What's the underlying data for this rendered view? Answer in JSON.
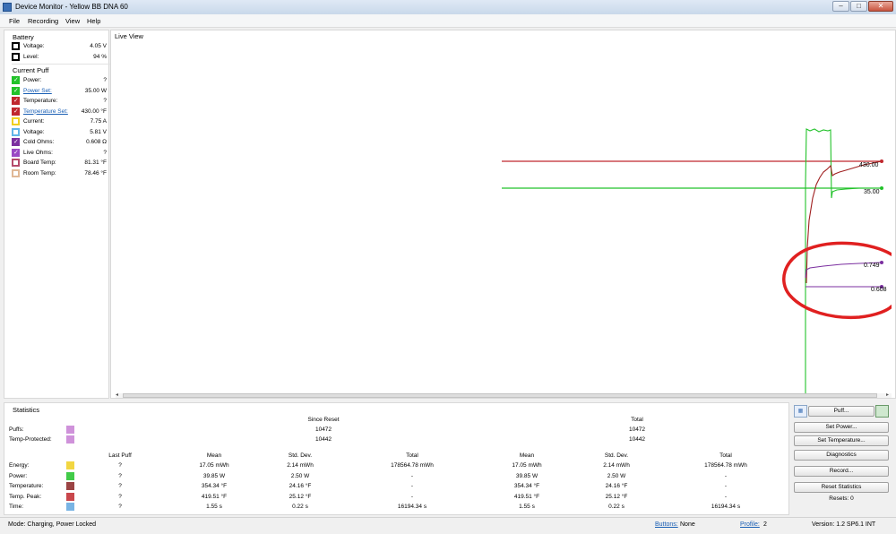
{
  "window": {
    "title": "Device Monitor - Yellow BB DNA 60"
  },
  "menu": [
    "File",
    "Recording",
    "View",
    "Help"
  ],
  "battery": {
    "heading": "Battery",
    "rows": [
      {
        "label": "Voltage:",
        "value": "4.05 V",
        "color": "#000000"
      },
      {
        "label": "Level:",
        "value": "94 %",
        "color": "#000000"
      }
    ]
  },
  "current_puff": {
    "heading": "Current Puff",
    "rows": [
      {
        "label": "Power:",
        "value": "?",
        "color": "#22c22a",
        "checked": true,
        "link": false
      },
      {
        "label": "Power Set:",
        "value": "35.00 W",
        "color": "#22c22a",
        "checked": true,
        "link": true
      },
      {
        "label": "Temperature:",
        "value": "?",
        "color": "#c0272d",
        "checked": true,
        "link": false
      },
      {
        "label": "Temperature Set:",
        "value": "430.00 °F",
        "color": "#c0272d",
        "checked": true,
        "link": true
      },
      {
        "label": "Current:",
        "value": "7.75 A",
        "color": "#f0d020",
        "checked": false,
        "link": false
      },
      {
        "label": "Voltage:",
        "value": "5.81 V",
        "color": "#62b6e8",
        "checked": false,
        "link": false
      },
      {
        "label": "Cold Ohms:",
        "value": "0.608 Ω",
        "color": "#7b2fa0",
        "checked": true,
        "link": false
      },
      {
        "label": "Live Ohms:",
        "value": "?",
        "color": "#9a48c4",
        "checked": true,
        "link": false
      },
      {
        "label": "Board Temp:",
        "value": "81.31 °F",
        "color": "#b44a6a",
        "checked": false,
        "link": false
      },
      {
        "label": "Room Temp:",
        "value": "78.46 °F",
        "color": "#e0b896",
        "checked": false,
        "link": false
      }
    ]
  },
  "live_view": {
    "heading": "Live View"
  },
  "chart_data": {
    "type": "line",
    "series_colors": {
      "power": "#22c22a",
      "temperature": "#c0272d",
      "ohms": "#7b2fa0"
    },
    "end_labels": [
      "430.00",
      "35.00",
      "0.749",
      "0.608"
    ],
    "annotation": "red hand-drawn circle around ohms traces"
  },
  "statistics": {
    "heading": "Statistics",
    "since_reset_label": "Since Reset",
    "total_label": "Total",
    "top_rows": [
      {
        "label": "Puffs:",
        "since_reset": "10472",
        "total": "10472",
        "color": "#c77fd4"
      },
      {
        "label": "Temp-Protected:",
        "since_reset": "10442",
        "total": "10442",
        "color": "#c77fd4"
      }
    ],
    "columns": [
      "Last Puff",
      "Mean",
      "Std. Dev.",
      "Total",
      "Mean",
      "Std. Dev.",
      "Total"
    ],
    "rows": [
      {
        "label": "Energy:",
        "color": "#f0d020",
        "values": [
          "?",
          "17.05 mWh",
          "2.14 mWh",
          "178564.78 mWh",
          "17.05 mWh",
          "2.14 mWh",
          "178564.78 mWh"
        ]
      },
      {
        "label": "Power:",
        "color": "#22c22a",
        "values": [
          "?",
          "39.85 W",
          "2.50 W",
          "-",
          "39.85 W",
          "2.50 W",
          "-"
        ]
      },
      {
        "label": "Temperature:",
        "color": "#8a2424",
        "values": [
          "?",
          "354.34 °F",
          "24.16 °F",
          "-",
          "354.34 °F",
          "24.16 °F",
          "-"
        ]
      },
      {
        "label": "Temp. Peak:",
        "color": "#c0272d",
        "values": [
          "?",
          "419.51 °F",
          "25.12 °F",
          "-",
          "419.51 °F",
          "25.12 °F",
          "-"
        ]
      },
      {
        "label": "Time:",
        "color": "#62a8e0",
        "values": [
          "?",
          "1.55 s",
          "0.22 s",
          "16194.34 s",
          "1.55 s",
          "0.22 s",
          "16194.34 s"
        ]
      }
    ]
  },
  "buttons": {
    "puff": "Puff...",
    "set_power": "Set Power...",
    "set_temperature": "Set Temperature...",
    "diagnostics": "Diagnostics",
    "record": "Record...",
    "reset_statistics": "Reset Statistics",
    "resets": "Resets: 0"
  },
  "status": {
    "mode": "Mode: Charging, Power Locked",
    "buttons_label": "Buttons:",
    "buttons_value": "None",
    "profile_label": "Profile:",
    "profile_value": "2",
    "version": "Version: 1.2 SP6.1 INT"
  }
}
